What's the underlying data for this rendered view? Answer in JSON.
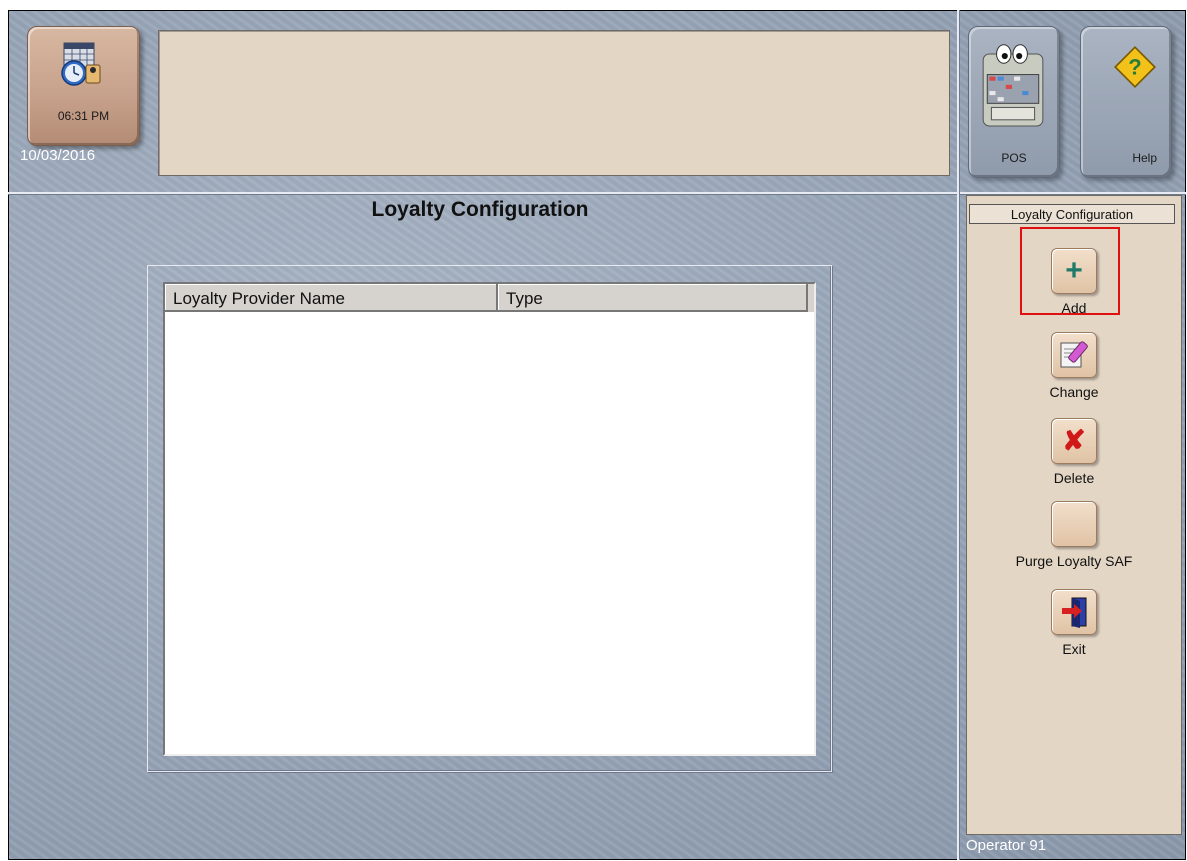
{
  "header": {
    "time": "06:31 PM",
    "date": "10/03/2016"
  },
  "toolbar": {
    "pos_label": "POS",
    "help_label": "Help"
  },
  "screen": {
    "title": "Loyalty Configuration"
  },
  "table": {
    "columns": [
      "Loyalty Provider Name",
      "Type"
    ],
    "rows": []
  },
  "actions": {
    "panel_title": "Loyalty Configuration",
    "items": [
      {
        "label": "Add",
        "icon": "plus-icon"
      },
      {
        "label": "Change",
        "icon": "edit-icon"
      },
      {
        "label": "Delete",
        "icon": "delete-x-icon"
      },
      {
        "label": "Purge Loyalty SAF",
        "icon": ""
      },
      {
        "label": "Exit",
        "icon": "exit-door-icon"
      }
    ]
  },
  "status_bar": {
    "operator": "Operator 91"
  },
  "colors": {
    "highlight": "#e01010",
    "panel_beige": "#e3d6c5",
    "background_blue_gray": "#95a3b6"
  }
}
